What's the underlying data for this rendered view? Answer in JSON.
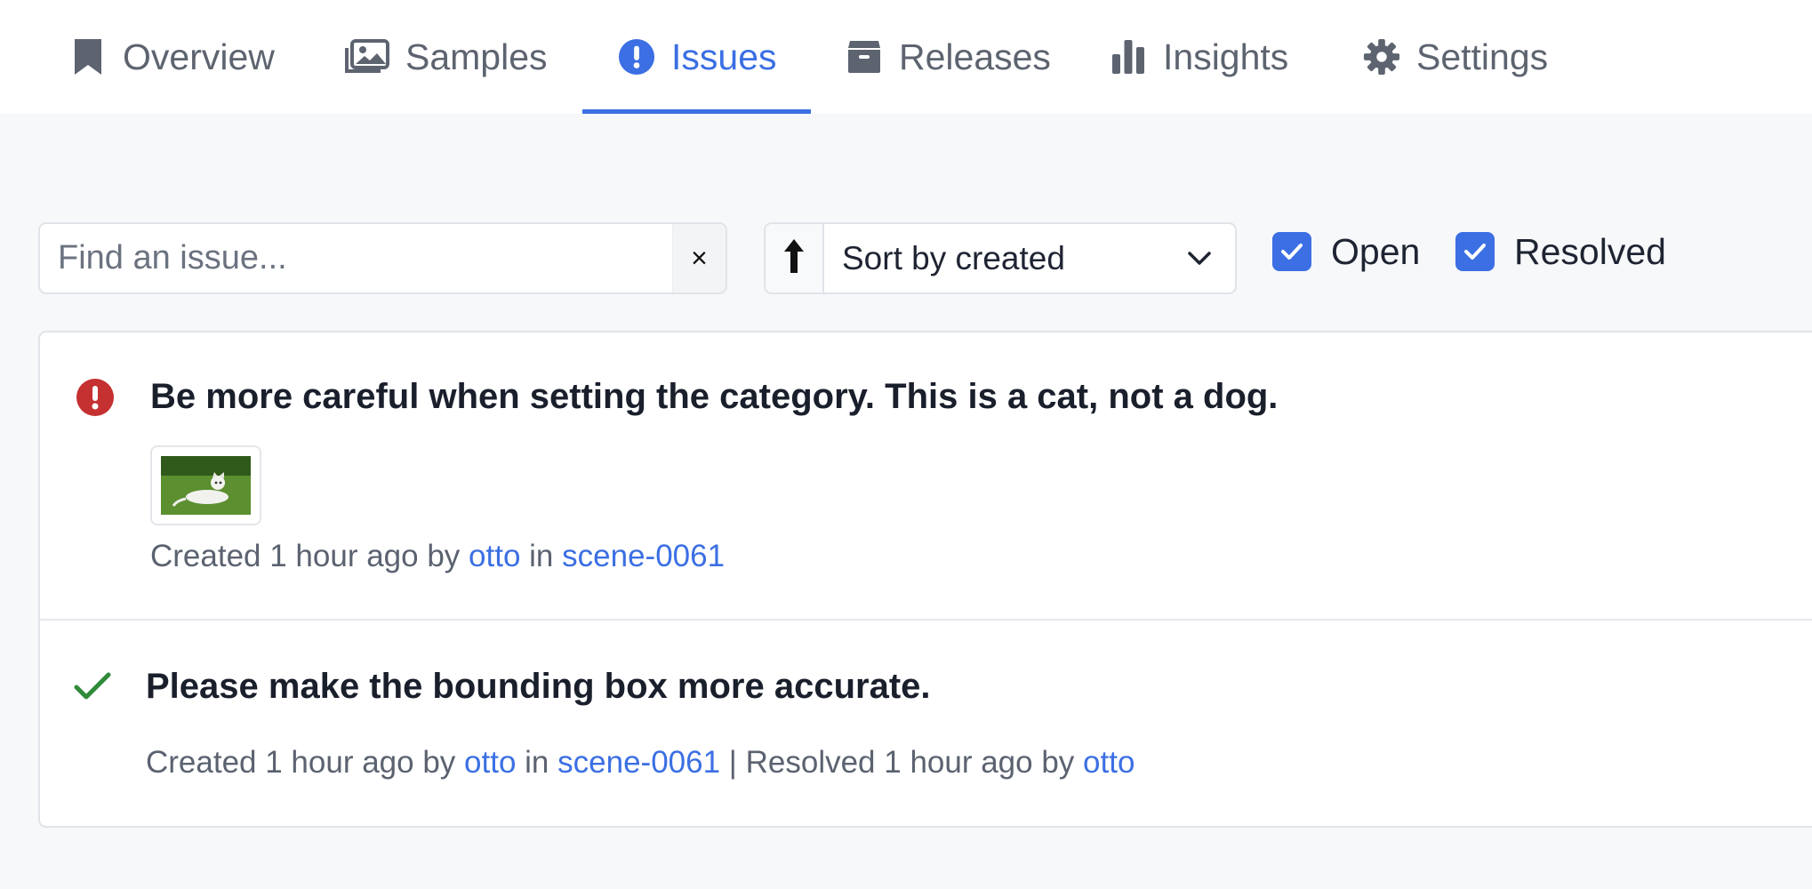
{
  "tabs": [
    {
      "label": "Overview",
      "icon": "bookmark-icon"
    },
    {
      "label": "Samples",
      "icon": "images-icon"
    },
    {
      "label": "Issues",
      "icon": "exclamation-circle-icon",
      "active": true
    },
    {
      "label": "Releases",
      "icon": "box-icon"
    },
    {
      "label": "Insights",
      "icon": "bar-chart-icon"
    },
    {
      "label": "Settings",
      "icon": "gear-icon"
    }
  ],
  "search": {
    "placeholder": "Find an issue...",
    "value": "",
    "clear_label": "×"
  },
  "sort": {
    "label": "Sort by created",
    "direction": "ascending"
  },
  "filters": {
    "open_label": "Open",
    "open_checked": true,
    "resolved_label": "Resolved",
    "resolved_checked": true
  },
  "issues": [
    {
      "status": "open",
      "title": "Be more careful when setting the category. This is a cat, not a dog.",
      "created_prefix": "Created 1 hour ago by",
      "user": "otto",
      "in_text": "in",
      "scene": "scene-0061"
    },
    {
      "status": "resolved",
      "title": "Please make the bounding box more accurate.",
      "created_prefix": "Created 1 hour ago by",
      "user": "otto",
      "in_text": "in",
      "scene": "scene-0061",
      "resolved_text": "| Resolved 1 hour ago by",
      "resolved_user": "otto"
    }
  ],
  "colors": {
    "accent": "#3b6fe3",
    "open_status": "#c53030",
    "resolved_status": "#2f8a3a"
  }
}
